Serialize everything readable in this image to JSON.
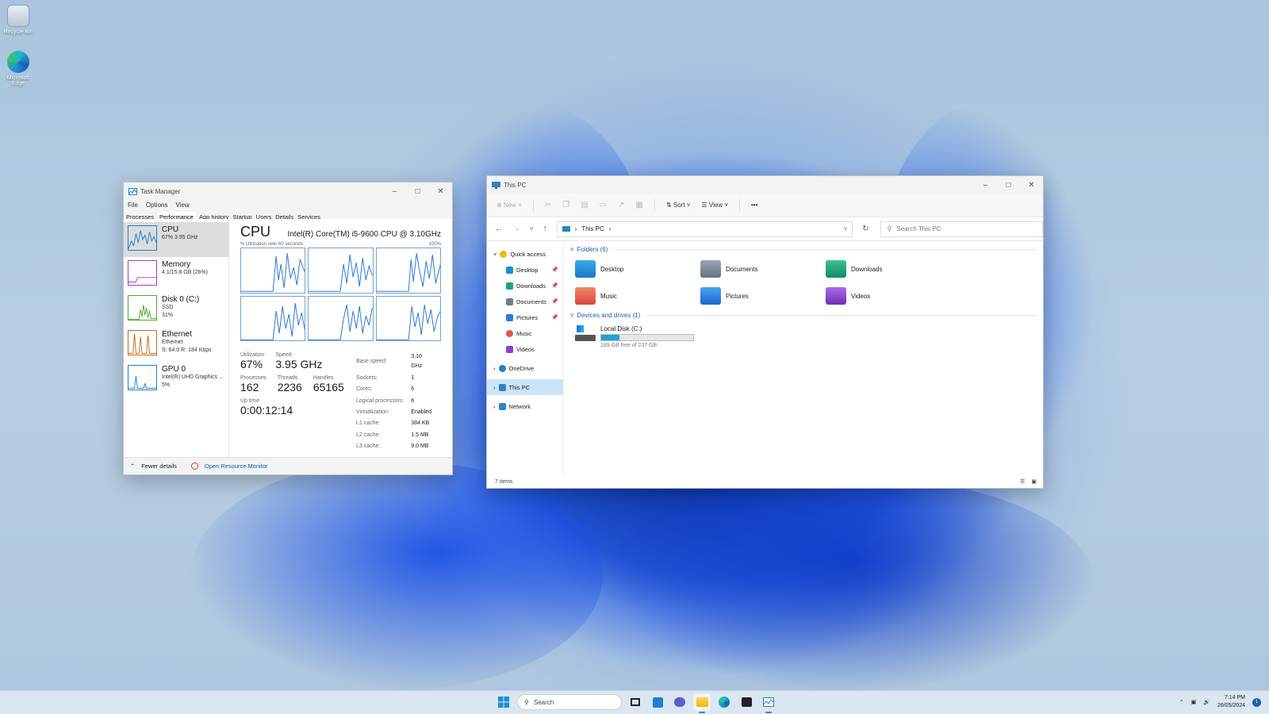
{
  "desktop": {
    "icons": [
      {
        "label": "Recycle Bin",
        "icon": "recycle-bin-icon"
      },
      {
        "label": "Microsoft Edge",
        "icon": "edge-icon"
      }
    ]
  },
  "task_manager": {
    "title": "Task Manager",
    "menu": [
      "File",
      "Options",
      "View"
    ],
    "tabs": [
      "Processes",
      "Performance",
      "App history",
      "Startup",
      "Users",
      "Details",
      "Services"
    ],
    "active_tab": "Performance",
    "resources": [
      {
        "name": "CPU",
        "sub1": "67%  3.95 GHz",
        "sub2": "",
        "sub3": "",
        "color": "#1f7fd1"
      },
      {
        "name": "Memory",
        "sub1": "4.1/15.8 GB (26%)",
        "sub2": "",
        "sub3": "",
        "color": "#a43ac9"
      },
      {
        "name": "Disk 0 (C:)",
        "sub1": "SSD",
        "sub2": "31%",
        "sub3": "",
        "color": "#4fa82e"
      },
      {
        "name": "Ethernet",
        "sub1": "Ethernet",
        "sub2": "S: 64.0  R: 184 Kbps",
        "sub3": "",
        "color": "#c46a1b"
      },
      {
        "name": "GPU 0",
        "sub1": "Intel(R) UHD Graphics ...",
        "sub2": "5%",
        "sub3": "",
        "color": "#1f7fd1"
      }
    ],
    "cpu": {
      "title": "CPU",
      "model": "Intel(R) Core(TM) i5-9600 CPU @ 3.10GHz",
      "graph_label": "% Utilization over 60 seconds",
      "graph_max": "100%",
      "utilization_label": "Utilization",
      "utilization": "67%",
      "speed_label": "Speed",
      "speed": "3.95 GHz",
      "processes_label": "Processes",
      "processes": "162",
      "threads_label": "Threads",
      "threads": "2236",
      "handles_label": "Handles",
      "handles": "65165",
      "uptime_label": "Up time",
      "uptime": "0:00:12:14",
      "details": [
        {
          "k": "Base speed:",
          "v": "3.10 GHz"
        },
        {
          "k": "Sockets:",
          "v": "1"
        },
        {
          "k": "Cores:",
          "v": "6"
        },
        {
          "k": "Logical processors:",
          "v": "6"
        },
        {
          "k": "Virtualization:",
          "v": "Enabled"
        },
        {
          "k": "L1 cache:",
          "v": "384 KB"
        },
        {
          "k": "L2 cache:",
          "v": "1.5 MB"
        },
        {
          "k": "L3 cache:",
          "v": "9.0 MB"
        }
      ]
    },
    "footer": {
      "fewer_details": "Fewer details",
      "resource_monitor": "Open Resource Monitor"
    }
  },
  "explorer": {
    "title": "This PC",
    "toolbar": {
      "new": "New",
      "sort": "Sort",
      "view": "View",
      "more": "•••"
    },
    "address": "This PC",
    "search_placeholder": "Search This PC",
    "nav": [
      {
        "label": "Quick access",
        "level": 1,
        "pinned": false,
        "color": "#f2b600",
        "expanded": true
      },
      {
        "label": "Desktop",
        "level": 2,
        "pinned": true,
        "color": "#1a8fd6"
      },
      {
        "label": "Downloads",
        "level": 2,
        "pinned": true,
        "color": "#1aa67a"
      },
      {
        "label": "Documents",
        "level": 2,
        "pinned": true,
        "color": "#6f7d8c"
      },
      {
        "label": "Pictures",
        "level": 2,
        "pinned": true,
        "color": "#2b7ad6"
      },
      {
        "label": "Music",
        "level": 2,
        "pinned": false,
        "color": "#e2554a"
      },
      {
        "label": "Videos",
        "level": 2,
        "pinned": false,
        "color": "#8a3fd1"
      },
      {
        "label": "OneDrive",
        "level": 1,
        "pinned": false,
        "color": "#1f7fd1",
        "expanded": false
      },
      {
        "label": "This PC",
        "level": 1,
        "pinned": false,
        "color": "#2a84c9",
        "expanded": false,
        "selected": true
      },
      {
        "label": "Network",
        "level": 1,
        "pinned": false,
        "color": "#2a84c9",
        "expanded": false
      }
    ],
    "folders_header": "Folders (6)",
    "folders": [
      {
        "label": "Desktop",
        "color": "#1a8fd6"
      },
      {
        "label": "Documents",
        "color": "#6f7d8c"
      },
      {
        "label": "Downloads",
        "color": "#1aa67a"
      },
      {
        "label": "Music",
        "color": "#e2604f"
      },
      {
        "label": "Pictures",
        "color": "#2b7ad6"
      },
      {
        "label": "Videos",
        "color": "#8a3fd1"
      }
    ],
    "drives_header": "Devices and drives (1)",
    "drive": {
      "label": "Local Disk (C:)",
      "free": "189 GB free of 237 GB",
      "used_fraction": 0.2
    },
    "status": "7 items"
  },
  "taskbar": {
    "search_label": "Search",
    "time": "7:14 PM",
    "date": "26/05/2024",
    "notifications": "1"
  },
  "colors": {
    "accent": "#1f7fd1",
    "selection": "#cce4f7"
  }
}
